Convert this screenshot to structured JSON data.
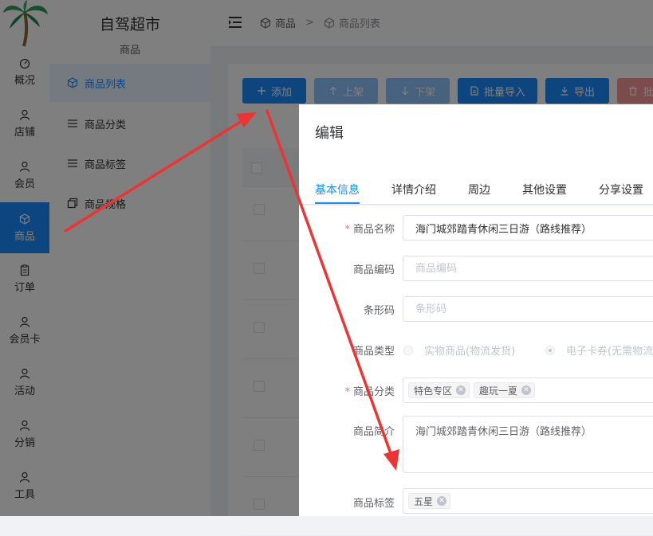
{
  "rail": {
    "items": [
      {
        "label": "概况",
        "icon": "dashboard-icon"
      },
      {
        "label": "店铺",
        "icon": "user-icon"
      },
      {
        "label": "会员",
        "icon": "user-icon"
      },
      {
        "label": "商品",
        "icon": "cube-icon"
      },
      {
        "label": "订单",
        "icon": "clipboard-icon"
      },
      {
        "label": "会员卡",
        "icon": "user-icon"
      },
      {
        "label": "活动",
        "icon": "user-icon"
      },
      {
        "label": "分销",
        "icon": "user-icon"
      },
      {
        "label": "工具",
        "icon": "user-icon"
      }
    ],
    "active": "商品"
  },
  "subnav": {
    "store_name": "自驾超市",
    "section": "商品",
    "items": [
      {
        "label": "商品列表",
        "icon": "cube-icon"
      },
      {
        "label": "商品分类",
        "icon": "list-icon"
      },
      {
        "label": "商品标签",
        "icon": "list-icon"
      },
      {
        "label": "商品规格",
        "icon": "copy-icon"
      }
    ]
  },
  "breadcrumb": {
    "root": "商品",
    "separator": ">",
    "current": "商品列表"
  },
  "toolbar": {
    "add": "添加",
    "up": "上架",
    "down": "下架",
    "import": "批量导入",
    "export": "导出",
    "delete": "批"
  },
  "dialog": {
    "title": "编辑",
    "tabs": [
      "基本信息",
      "详情介绍",
      "周边",
      "其他设置",
      "分享设置"
    ],
    "fields": {
      "name_label": "商品名称",
      "name_value": "海门城郊踏青休闲三日游（路线推荐）",
      "code_label": "商品编码",
      "code_placeholder": "商品编码",
      "barcode_label": "条形码",
      "barcode_placeholder": "条形码",
      "type_label": "商品类型",
      "type_option_physical": "实物商品(物流发货)",
      "type_option_voucher": "电子卡券(无需物流",
      "category_label": "商品分类",
      "categories": [
        "特色专区",
        "趣玩一夏"
      ],
      "desc_label": "商品简介",
      "desc_value": "海门城郊踏青休闲三日游（路线推荐）",
      "tags_label": "商品标签",
      "tags": [
        "五星"
      ]
    }
  },
  "colors": {
    "primary": "#1a8cff",
    "annotation_arrow": "#ee3333"
  }
}
